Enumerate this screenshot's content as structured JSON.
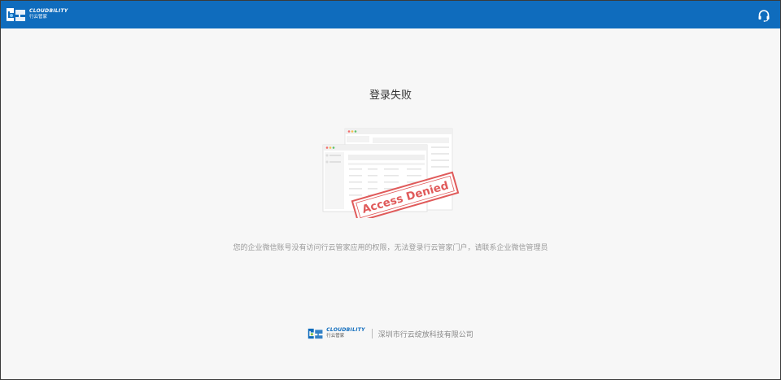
{
  "header": {
    "logo": {
      "en": "CLOUDBILITY",
      "cn": "行云管家",
      "icon": "cloudbility-logo"
    },
    "support_icon": "headset-icon",
    "colors": {
      "bar": "#0f6cbd",
      "text": "#ffffff"
    }
  },
  "main": {
    "title": "登录失败",
    "stamp_text": "Access Denied",
    "stamp_color": "#e05a5a",
    "message": "您的企业微信账号没有访问行云管家应用的权限，无法登录行云管家门户，请联系企业微信管理员"
  },
  "footer": {
    "logo": {
      "en": "CLOUDBILITY",
      "cn": "行云管家",
      "icon": "cloudbility-logo"
    },
    "company": "深圳市行云绽放科技有限公司"
  }
}
